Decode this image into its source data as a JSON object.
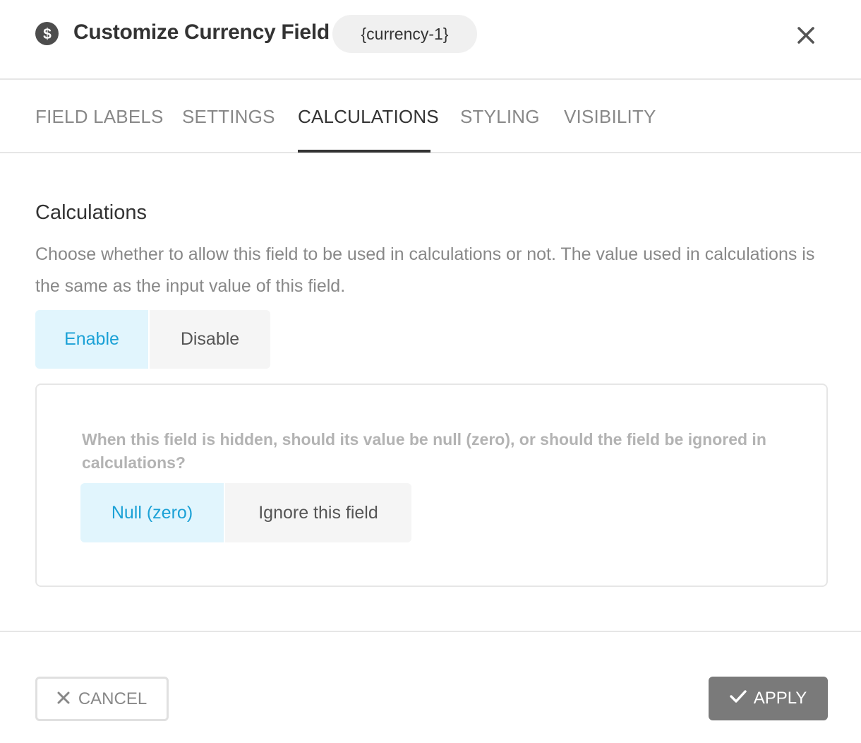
{
  "header": {
    "title": "Customize Currency Field",
    "tag": "{currency-1}",
    "icon": "dollar-icon",
    "close_icon": "close-icon"
  },
  "tabs": [
    {
      "label": "FIELD LABELS",
      "active": false
    },
    {
      "label": "SETTINGS",
      "active": false
    },
    {
      "label": "CALCULATIONS",
      "active": true
    },
    {
      "label": "STYLING",
      "active": false
    },
    {
      "label": "VISIBILITY",
      "active": false
    }
  ],
  "calculations": {
    "title": "Calculations",
    "description": "Choose whether to allow this field to be used in calculations or not. The value used in calculations is the same as the input value of this field.",
    "options": [
      {
        "label": "Enable",
        "selected": true
      },
      {
        "label": "Disable",
        "selected": false
      }
    ]
  },
  "hidden_behavior": {
    "question": "When this field is hidden, should its value be null (zero), or should the field be ignored in calculations?",
    "options": [
      {
        "label": "Null (zero)",
        "selected": true
      },
      {
        "label": "Ignore this field",
        "selected": false
      }
    ]
  },
  "footer": {
    "cancel_label": "CANCEL",
    "apply_label": "APPLY"
  },
  "colors": {
    "accent": "#1ba1d6",
    "accent_bg": "#e1f5fd",
    "apply_bg": "#7a7a7a"
  }
}
